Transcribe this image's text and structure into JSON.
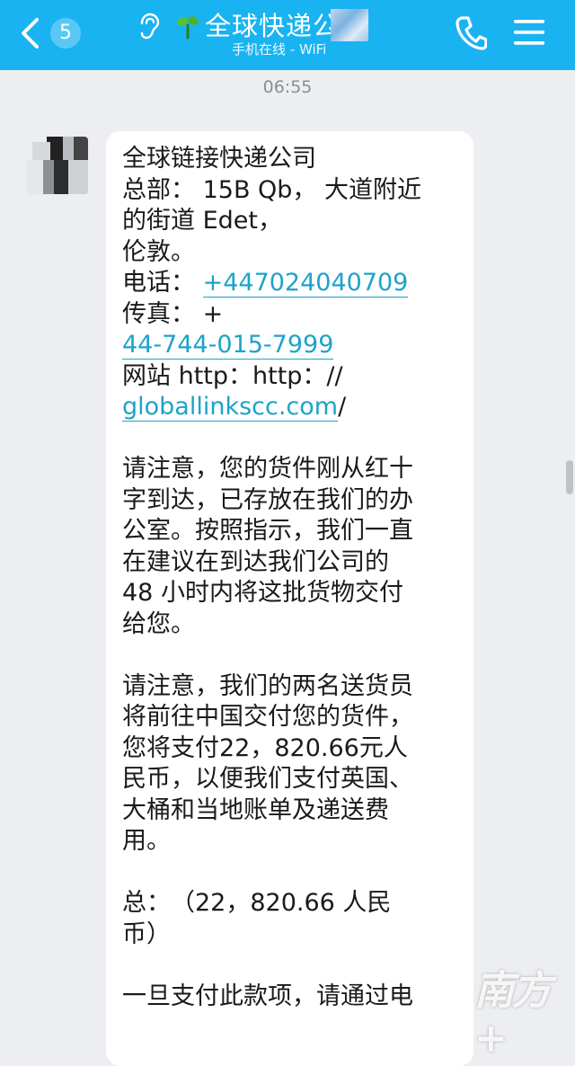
{
  "header": {
    "badge_count": "5",
    "title": "全球快递公",
    "subtitle": "手机在线 - WiFi",
    "back_icon": "chevron-left-icon",
    "ear_icon": "ear-icon",
    "status_icon": "sprout-icon",
    "phone_icon": "phone-icon",
    "menu_icon": "hamburger-menu-icon",
    "color": "#19b3f2"
  },
  "chat": {
    "timestamp": "06:55",
    "message": {
      "company": "全球链接快递公司",
      "address_l1": "总部： 15B Qb， 大道附近",
      "address_l2": "的街道 Edet，",
      "address_l3": "伦敦。",
      "phone_label": "电话：",
      "phone_link": "+447024040709",
      "fax_label": "传真： +",
      "fax_link": "44-744-015-7999",
      "site_label": "网站 http：http：//",
      "site_link": "globallinkscc.com",
      "site_suffix": "/",
      "p1": [
        "请注意，您的货件刚从红十",
        "字到达，已存放在我们的办",
        "公室。按照指示，我们一直",
        "在建议在到达我们公司的",
        "48 小时内将这批货物交付",
        "给您。"
      ],
      "p2": [
        "请注意，我们的两名送货员",
        "将前往中国交付您的货件，",
        "您将支付22，820.66元人",
        "民币，以便我们支付英国、",
        "大桶和当地账单及递送费",
        "用。"
      ],
      "total_l1": "总：　（22，820.66 人民",
      "total_l2": "币）",
      "p3_l1": "一旦支付此款项，请通过电"
    }
  },
  "watermark": "南方+"
}
